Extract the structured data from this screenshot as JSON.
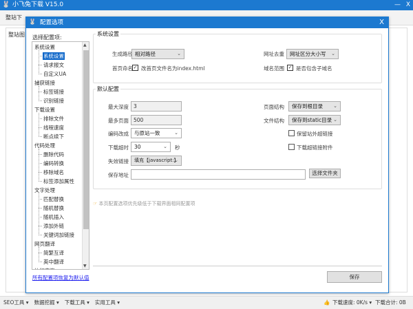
{
  "app": {
    "title": "小飞兔下载 V15.0",
    "min": "—",
    "close": "X",
    "toolbar_item": "整站下",
    "bg_tab": "整站图"
  },
  "dialog": {
    "title": "配置选项",
    "close": "X",
    "list_label": "选择配置项:",
    "tree": [
      {
        "label": "系统设置",
        "children": [
          "系统设置",
          "请求报文",
          "自定义UA"
        ]
      },
      {
        "label": "捕获链接",
        "children": [
          "标签链接",
          "识别链接"
        ]
      },
      {
        "label": "下载设置",
        "children": [
          "排除文件",
          "线程速度",
          "断点续下"
        ]
      },
      {
        "label": "代码处理",
        "children": [
          "删除代码",
          "编码转换",
          "移除域名",
          "标签添加属性"
        ]
      },
      {
        "label": "文字处理",
        "children": [
          "匹配替换",
          "随机替换",
          "随机插入",
          "添加外链",
          "关键词加链接"
        ]
      },
      {
        "label": "网页翻译",
        "children": [
          "简繁互译",
          "英中翻译"
        ]
      },
      {
        "label": "执行完毕",
        "children": []
      }
    ],
    "system": {
      "title": "系统设置",
      "path_label": "生成路径",
      "path_value": "相对路径",
      "home_label": "首页命名",
      "home_check": "改首页文件名为index.html",
      "dedupe_label": "网址去重",
      "dedupe_value": "网址区分大小写",
      "domain_label": "域名范围",
      "domain_check": "是否包含子域名"
    },
    "defaults": {
      "title": "默认配置",
      "depth_label": "最大深度",
      "depth_value": "3",
      "pages_label": "最多页面",
      "pages_value": "500",
      "encoding_label": "编码改成",
      "encoding_value": "与原站一致",
      "timeout_label": "下载超时",
      "timeout_value": "30",
      "timeout_unit": "秒",
      "broken_label": "失效链接",
      "broken_value": "填充【javascript:】",
      "save_label": "保存地址",
      "save_value": "",
      "choose_folder": "选择文件夹",
      "page_struct_label": "页面结构",
      "page_struct_value": "保存到根目录",
      "file_struct_label": "文件结构",
      "file_struct_value": "保存到static目录",
      "keep_external": "保留站外超链接",
      "download_attach": "下载超链接附件"
    },
    "note": "本页配置选项优先级低于下载界面相同配置项",
    "reset_link": "所有配置项恢复为默认值",
    "save": "保存"
  },
  "statusbar": {
    "menus": [
      "SEO工具 ▾",
      "数据挖掘 ▾",
      "下载工具 ▾",
      "实用工具 ▾"
    ],
    "speed": "下载速度: 0K/s ▾",
    "total": "下载合计: 0B"
  }
}
